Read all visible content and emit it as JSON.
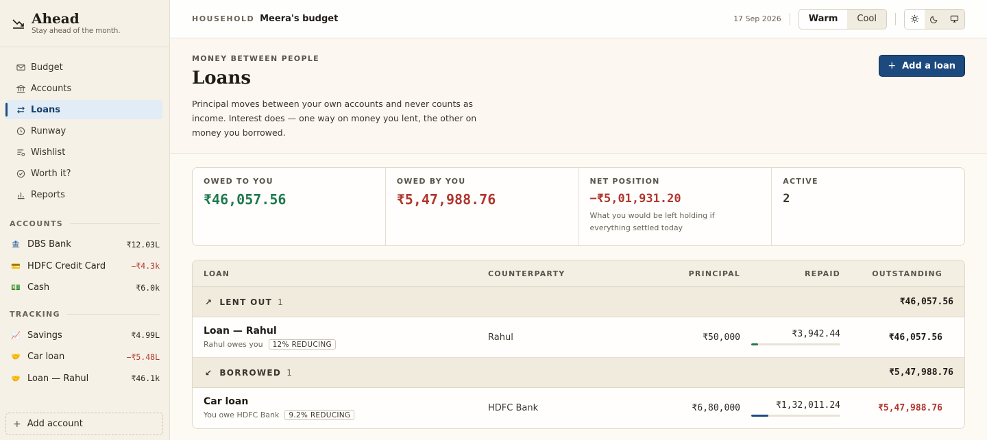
{
  "brand": {
    "name": "Ahead",
    "tagline": "Stay ahead of the month."
  },
  "nav": [
    {
      "label": "Budget",
      "icon": "mail-icon",
      "active": false
    },
    {
      "label": "Accounts",
      "icon": "bank-icon",
      "active": false
    },
    {
      "label": "Loans",
      "icon": "transfer-icon",
      "active": true
    },
    {
      "label": "Runway",
      "icon": "clock-icon",
      "active": false
    },
    {
      "label": "Wishlist",
      "icon": "list-icon",
      "active": false
    },
    {
      "label": "Worth it?",
      "icon": "check-circle-icon",
      "active": false
    },
    {
      "label": "Reports",
      "icon": "bar-chart-icon",
      "active": false
    }
  ],
  "accounts_section": {
    "title": "ACCOUNTS",
    "items": [
      {
        "emoji": "🏦",
        "name": "DBS Bank",
        "amount": "₹12.03L",
        "negative": false
      },
      {
        "emoji": "💳",
        "name": "HDFC Credit Card",
        "amount": "−₹4.3k",
        "negative": true
      },
      {
        "emoji": "💵",
        "name": "Cash",
        "amount": "₹6.0k",
        "negative": false
      }
    ]
  },
  "tracking_section": {
    "title": "TRACKING",
    "items": [
      {
        "emoji": "📈",
        "name": "Savings",
        "amount": "₹4.99L",
        "negative": false
      },
      {
        "emoji": "🤝",
        "name": "Car loan",
        "amount": "−₹5.48L",
        "negative": true
      },
      {
        "emoji": "🤝",
        "name": "Loan — Rahul",
        "amount": "₹46.1k",
        "negative": false
      }
    ]
  },
  "add_account_label": "Add account",
  "topbar": {
    "household_label": "HOUSEHOLD",
    "budget_name": "Meera's budget",
    "date": "17 Sep 2026",
    "theme_options": [
      "Warm",
      "Cool"
    ],
    "theme_selected": "Warm",
    "mode_icons": [
      "sun-icon",
      "moon-icon",
      "monitor-icon"
    ],
    "mode_selected": "sun-icon"
  },
  "hero": {
    "eyebrow": "MONEY BETWEEN PEOPLE",
    "title": "Loans",
    "intro": "Principal moves between your own accounts and never counts as income. Interest does — one way on money you lent, the other on money you borrowed.",
    "add_button": "Add a loan"
  },
  "stats": {
    "owed_to_you": {
      "label": "OWED TO YOU",
      "value": "₹46,057.56"
    },
    "owed_by_you": {
      "label": "OWED BY YOU",
      "value": "₹5,47,988.76"
    },
    "net_position": {
      "label": "NET POSITION",
      "value": "−₹5,01,931.20",
      "note": "What you would be left holding if everything settled today"
    },
    "active": {
      "label": "ACTIVE",
      "value": "2"
    }
  },
  "table": {
    "headers": {
      "loan": "LOAN",
      "counterparty": "COUNTERPARTY",
      "principal": "PRINCIPAL",
      "repaid": "REPAID",
      "outstanding": "OUTSTANDING"
    },
    "groups": [
      {
        "label": "LENT OUT",
        "arrow": "↗",
        "count": "1",
        "total": "₹46,057.56",
        "rows": [
          {
            "name": "Loan — Rahul",
            "sub": "Rahul owes you",
            "chip": "12% REDUCING",
            "counterparty": "Rahul",
            "principal": "₹50,000",
            "repaid": "₹3,942.44",
            "repaid_fraction": 0.079,
            "bar_color": "#1f7a4f",
            "outstanding": "₹46,057.56",
            "outstanding_negative": false
          }
        ]
      },
      {
        "label": "BORROWED",
        "arrow": "↙",
        "count": "1",
        "total": "₹5,47,988.76",
        "rows": [
          {
            "name": "Car loan",
            "sub": "You owe HDFC Bank",
            "chip": "9.2% REDUCING",
            "counterparty": "HDFC Bank",
            "principal": "₹6,80,000",
            "repaid": "₹1,32,011.24",
            "repaid_fraction": 0.194,
            "bar_color": "#1c4a7e",
            "outstanding": "₹5,47,988.76",
            "outstanding_negative": true
          }
        ]
      }
    ]
  },
  "colors": {
    "accent": "#1c4a7e",
    "positive": "#1f7a4f",
    "negative": "#b0362e"
  }
}
